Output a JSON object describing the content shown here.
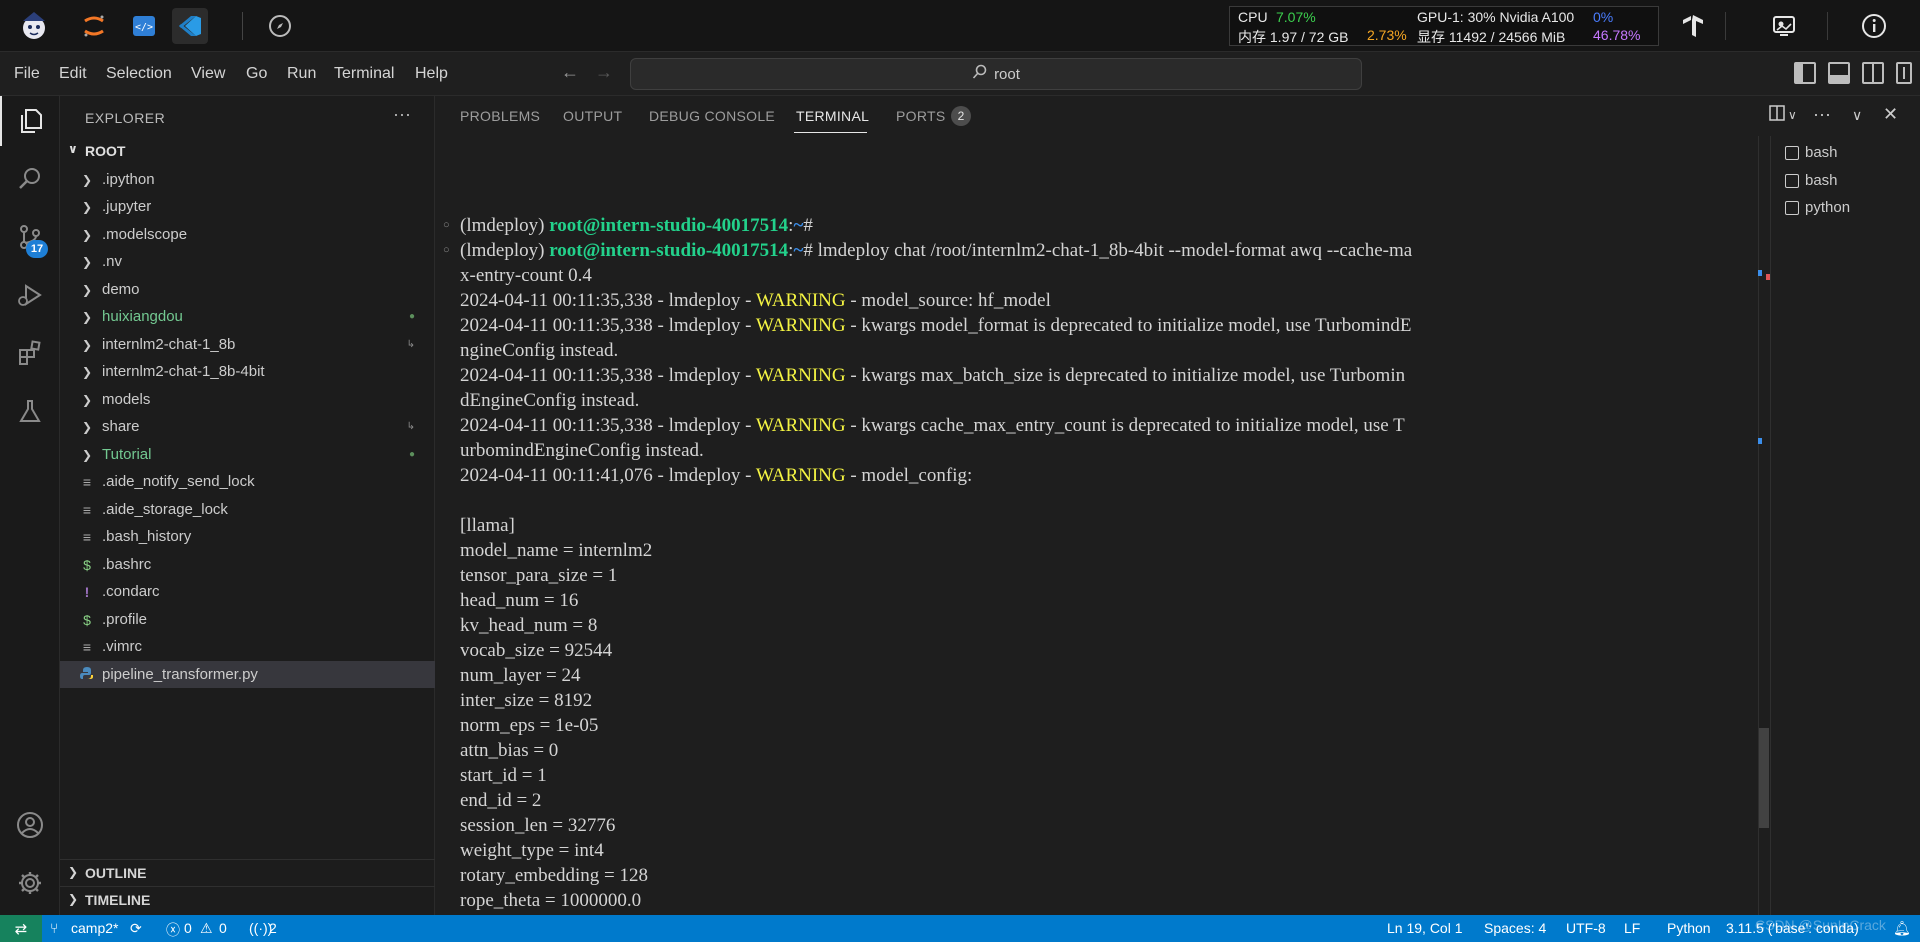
{
  "topbar": {
    "cpu_label": "CPU",
    "cpu_value": "7.07%",
    "mem_label": "内存 1.97 / 72 GB",
    "mem_value": "2.73%",
    "gpu_label": "GPU-1: 30% Nvidia A100",
    "gpu_value": "0%",
    "vram_label": "显存 11492 / 24566 MiB",
    "vram_value": "46.78%"
  },
  "menubar": {
    "items": [
      "File",
      "Edit",
      "Selection",
      "View",
      "Go",
      "Run",
      "Terminal",
      "Help"
    ],
    "search_text": "root"
  },
  "activity": {
    "scm_badge": "17"
  },
  "explorer": {
    "title": "EXPLORER",
    "more": "···",
    "root_label": "ROOT",
    "items": [
      {
        "label": ".ipython"
      },
      {
        "label": ".jupyter"
      },
      {
        "label": ".modelscope"
      },
      {
        "label": ".nv"
      },
      {
        "label": "demo"
      },
      {
        "label": "huixiangdou"
      },
      {
        "label": "internlm2-chat-1_8b"
      },
      {
        "label": "internlm2-chat-1_8b-4bit"
      },
      {
        "label": "models"
      },
      {
        "label": "share"
      },
      {
        "label": "Tutorial"
      },
      {
        "label": ".aide_notify_send_lock"
      },
      {
        "label": ".aide_storage_lock"
      },
      {
        "label": ".bash_history"
      },
      {
        "label": ".bashrc"
      },
      {
        "label": ".condarc"
      },
      {
        "label": ".profile"
      },
      {
        "label": ".vimrc"
      },
      {
        "label": "pipeline_transformer.py"
      }
    ],
    "outline": "OUTLINE",
    "timeline": "TIMELINE"
  },
  "panel": {
    "tabs": [
      "PROBLEMS",
      "OUTPUT",
      "DEBUG CONSOLE",
      "TERMINAL",
      "PORTS"
    ],
    "ports_count": "2"
  },
  "terminal": {
    "env": "(lmdeploy) ",
    "user_host": "root@intern-studio-40017514",
    "colon": ":",
    "path": "~",
    "prompt": "# ",
    "command1": "",
    "command2": "lmdeploy chat /root/internlm2-chat-1_8b-4bit --model-format awq --cache-ma",
    "command2_cont": "x-entry-count 0.4",
    "log_prefix1": "2024-04-11 00:11:35,338 - lmdeploy - ",
    "log_prefix2": "2024-04-11 00:11:41,076 - lmdeploy - ",
    "warning": "WARNING",
    "logs": [
      " - model_source: hf_model",
      " - kwargs model_format is deprecated to initialize model, use TurbomindE",
      "ngineConfig instead.",
      " - kwargs max_batch_size is deprecated to initialize model, use Turbomin",
      "dEngineConfig instead.",
      " - kwargs cache_max_entry_count is deprecated to initialize model, use T",
      "urbomindEngineConfig instead.",
      " - model_config:"
    ],
    "config_lines": [
      "[llama]",
      "model_name = internlm2",
      "tensor_para_size = 1",
      "head_num = 16",
      "kv_head_num = 8",
      "vocab_size = 92544",
      "num_layer = 24",
      "inter_size = 8192",
      "norm_eps = 1e-05",
      "attn_bias = 0",
      "start_id = 1",
      "end_id = 2",
      "session_len = 32776",
      "weight_type = int4",
      "rotary_embedding = 128",
      "rope_theta = 1000000.0"
    ]
  },
  "terminal_list": [
    "bash",
    "bash",
    "python"
  ],
  "statusbar": {
    "branch": "camp2*",
    "errors": "0",
    "warnings": "0",
    "ports": "2",
    "position": "Ln 19, Col 1",
    "spaces": "Spaces: 4",
    "encoding": "UTF-8",
    "eol": "LF",
    "language": "Python",
    "interpreter": "3.11.5 ('base': conda)"
  },
  "watermark": "CSDN @SunInCrack",
  "colors": {
    "accent": "#007acc",
    "green_prompt": "#23d18b",
    "warning": "#f5f543",
    "path_blue": "#3b8eea"
  },
  "icons": {
    "app_logo": "mascot-logo-icon",
    "jupyter": "jupyter-icon",
    "code": "code-icon",
    "vscode": "vscode-icon",
    "compass": "compass-icon",
    "tensorflow": "tensorflow-icon",
    "monitor": "monitor-icon",
    "info": "info-icon"
  }
}
